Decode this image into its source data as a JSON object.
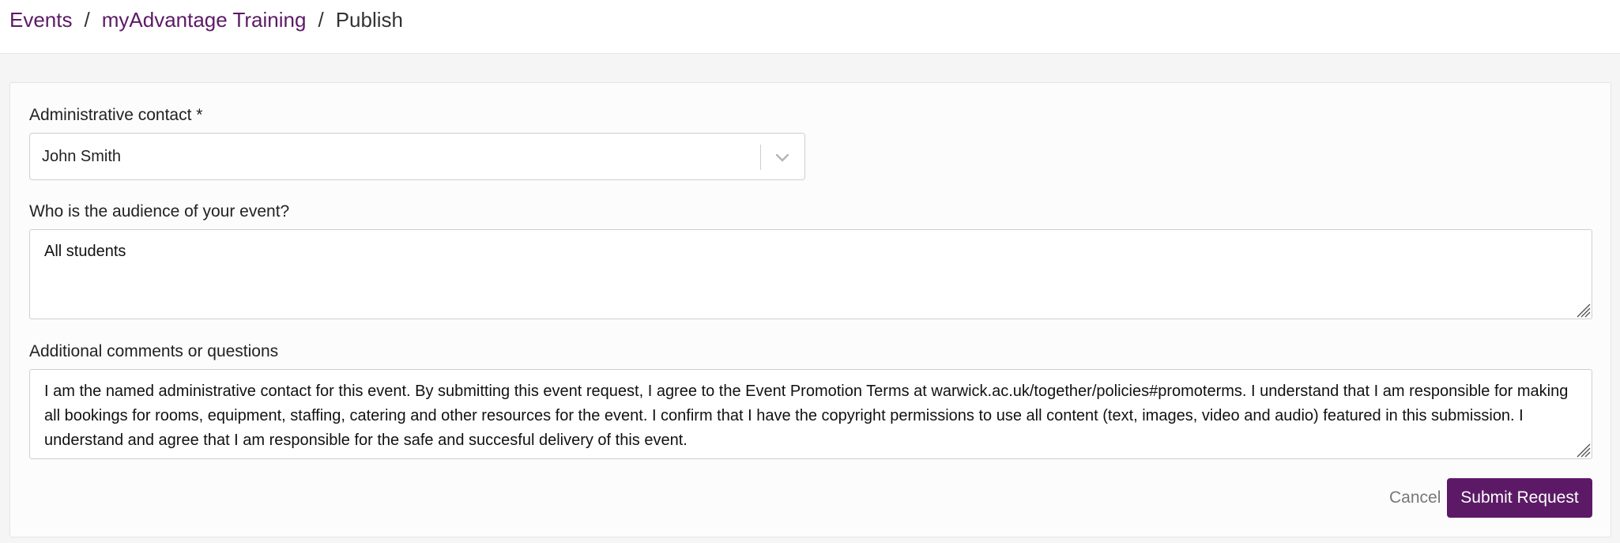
{
  "breadcrumb": {
    "items": [
      {
        "label": "Events"
      },
      {
        "label": "myAdvantage Training"
      },
      {
        "label": "Publish"
      }
    ],
    "separator": "/"
  },
  "form": {
    "admin_contact": {
      "label": "Administrative contact *",
      "value": "John Smith"
    },
    "audience": {
      "label": "Who is the audience of your event?",
      "value": "All students"
    },
    "comments": {
      "label": "Additional comments or questions",
      "value": "I am the named administrative contact for this event. By submitting this event request, I agree to the Event Promotion Terms at warwick.ac.uk/together/policies#promoterms. I understand that I am responsible for making all bookings for rooms, equipment, staffing, catering and other resources for the event. I confirm that I have the copyright permissions to use all content (text, images, video and audio) featured in this submission. I understand and agree that I am responsible for the safe and succesful delivery of this event."
    }
  },
  "actions": {
    "cancel_label": "Cancel",
    "submit_label": "Submit Request"
  },
  "colors": {
    "accent": "#5c1a66",
    "background": "#f5f5f5"
  },
  "icons": {
    "select_indicator": "chevron-down-icon",
    "resize": "resize-grip-icon"
  }
}
